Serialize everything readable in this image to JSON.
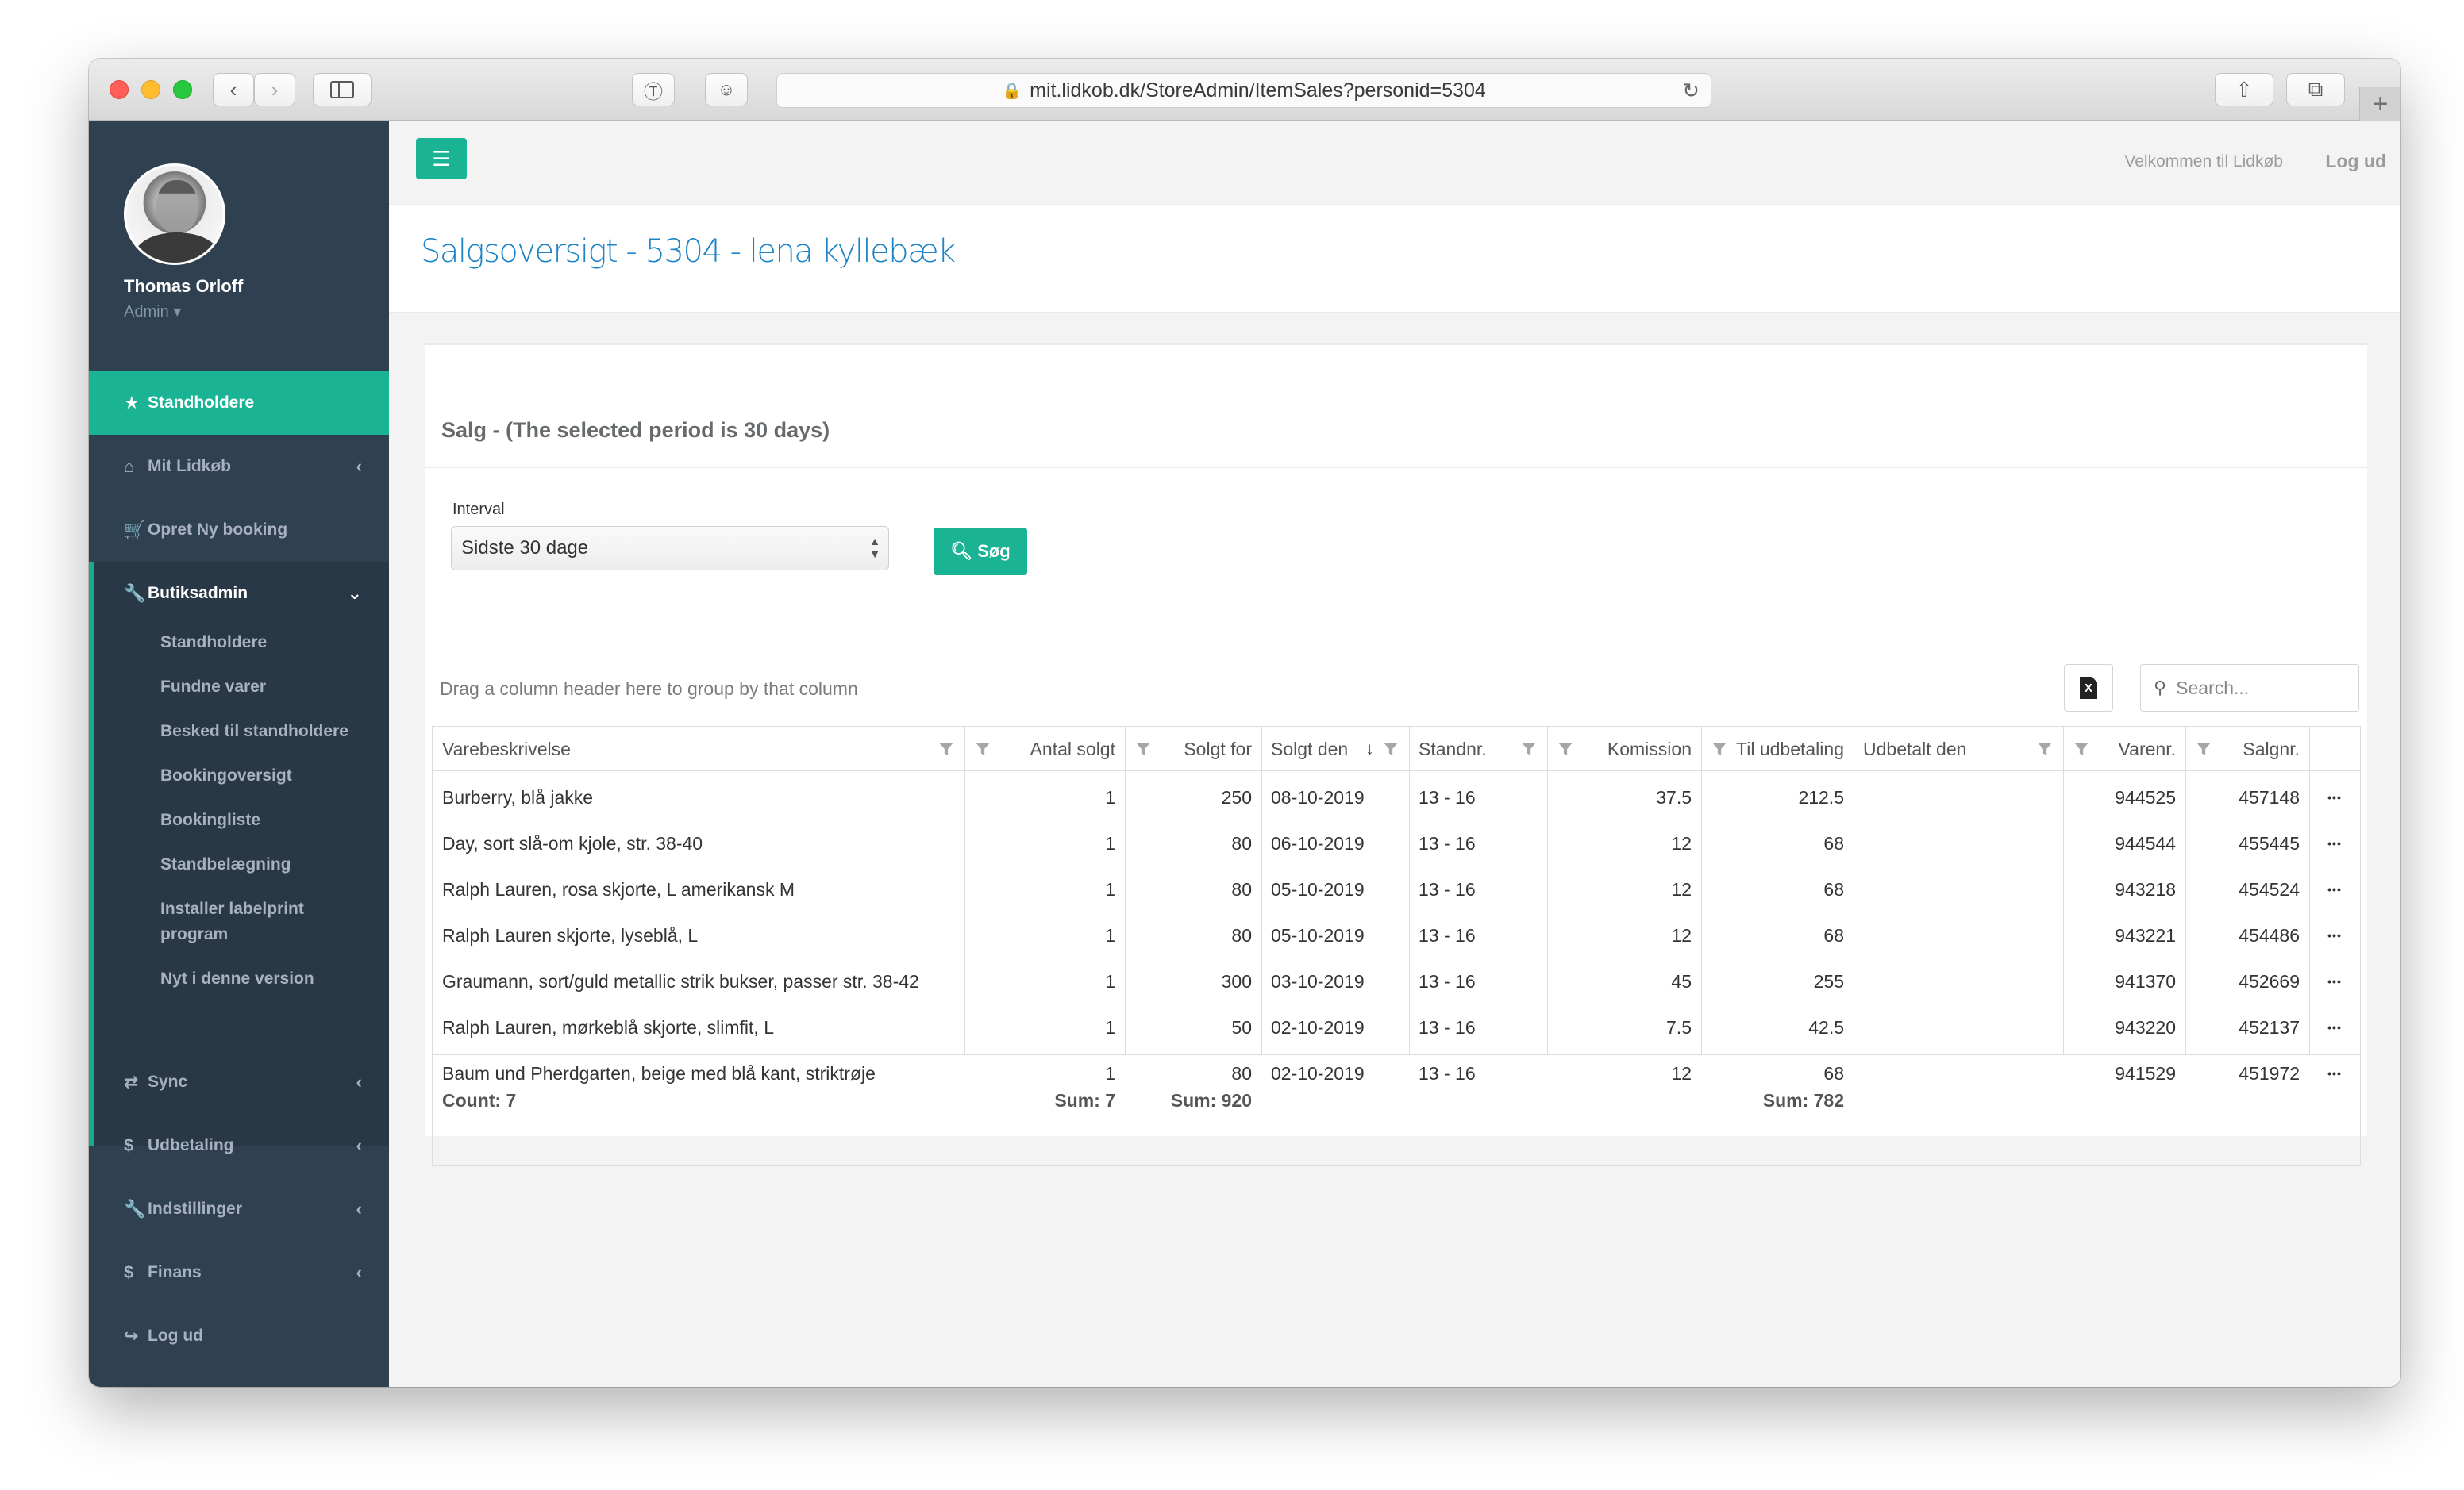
{
  "browser": {
    "url": "mit.lidkob.dk/StoreAdmin/ItemSales?personid=5304"
  },
  "profile": {
    "name": "Thomas Orloff",
    "role": "Admin ▾"
  },
  "nav": {
    "standholdere": "Standholdere",
    "mit_lidkob": "Mit Lidkøb",
    "opret": "Opret Ny booking",
    "butiksadmin": "Butiksadmin",
    "sub": [
      "Standholdere",
      "Fundne varer",
      "Besked til standholdere",
      "Bookingoversigt",
      "Bookingliste",
      "Standbelægning",
      "Installer labelprint program",
      "Nyt i denne version"
    ],
    "sync": "Sync",
    "udbetaling": "Udbetaling",
    "indstillinger": "Indstillinger",
    "finans": "Finans",
    "logud": "Log ud"
  },
  "topbar": {
    "welcome": "Velkommen til Lidkøb",
    "logout": "Log ud"
  },
  "page": {
    "title": "Salgsoversigt - 5304 - lena kyllebæk",
    "section_title": "Salg - (The selected period is 30 days)",
    "interval_label": "Interval",
    "interval_value": "Sidste 30 dage",
    "search_button": "Søg",
    "drag_hint": "Drag a column header here to group by that column",
    "search_placeholder": "Search..."
  },
  "grid": {
    "columns": [
      "Varebeskrivelse",
      "Antal solgt",
      "Solgt for",
      "Solgt den",
      "Standnr.",
      "Komission",
      "Til udbetaling",
      "Udbetalt den",
      "Varenr.",
      "Salgnr."
    ],
    "rows": [
      [
        "Burberry, blå jakke",
        "1",
        "250",
        "08-10-2019",
        "13 - 16",
        "37.5",
        "212.5",
        "",
        "944525",
        "457148"
      ],
      [
        "Day, sort slå-om kjole, str. 38-40",
        "1",
        "80",
        "06-10-2019",
        "13 - 16",
        "12",
        "68",
        "",
        "944544",
        "455445"
      ],
      [
        "Ralph Lauren, rosa skjorte, L amerikansk M",
        "1",
        "80",
        "05-10-2019",
        "13 - 16",
        "12",
        "68",
        "",
        "943218",
        "454524"
      ],
      [
        "Ralph Lauren skjorte, lyseblå, L",
        "1",
        "80",
        "05-10-2019",
        "13 - 16",
        "12",
        "68",
        "",
        "943221",
        "454486"
      ],
      [
        "Graumann, sort/guld metallic strik bukser, passer str. 38-42",
        "1",
        "300",
        "03-10-2019",
        "13 - 16",
        "45",
        "255",
        "",
        "941370",
        "452669"
      ],
      [
        "Ralph Lauren, mørkeblå skjorte, slimfit, L",
        "1",
        "50",
        "02-10-2019",
        "13 - 16",
        "7.5",
        "42.5",
        "",
        "943220",
        "452137"
      ],
      [
        "Baum und Pherdgarten, beige med blå kant, striktrøje",
        "1",
        "80",
        "02-10-2019",
        "13 - 16",
        "12",
        "68",
        "",
        "941529",
        "451972"
      ]
    ],
    "footer": {
      "count": "Count: 7",
      "sum_antal": "Sum: 7",
      "sum_solgt": "Sum: 920",
      "sum_udbetaling": "Sum: 782"
    }
  },
  "colors": {
    "accent": "#1ab394",
    "sidebar": "#2f4050",
    "title_blue": "#1c84c6"
  }
}
